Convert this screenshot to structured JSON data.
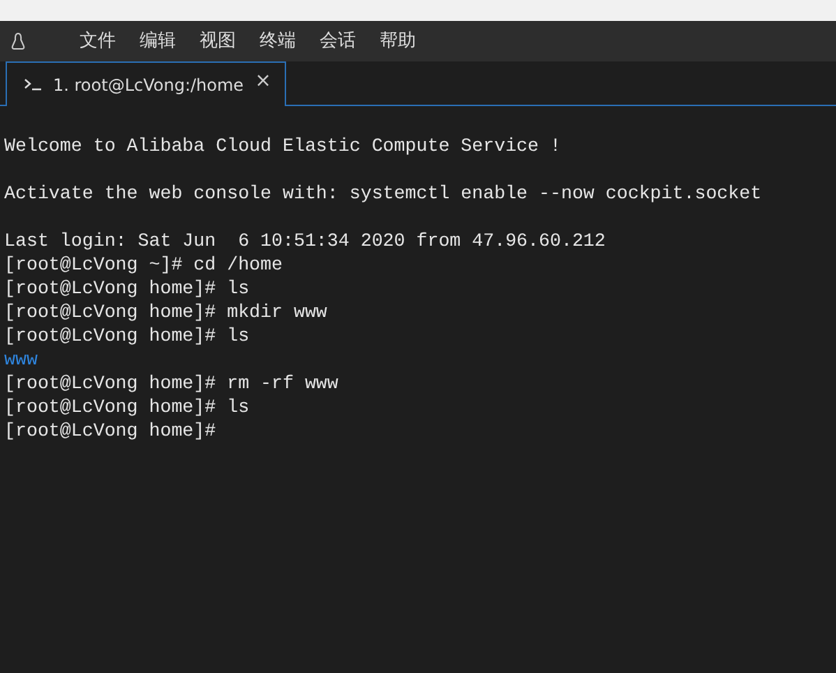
{
  "menu": [
    {
      "label": "文件"
    },
    {
      "label": "编辑"
    },
    {
      "label": "视图"
    },
    {
      "label": "终端"
    },
    {
      "label": "会话"
    },
    {
      "label": "帮助"
    }
  ],
  "tabs": [
    {
      "label": "1. root@LcVong:/home",
      "selected": true,
      "close": "×"
    }
  ],
  "terminal": {
    "blocks": [
      {
        "lines": [
          {
            "text": "Welcome to Alibaba Cloud Elastic Compute Service !",
            "kind": "output"
          }
        ]
      },
      {
        "lines": [
          {
            "text": "Activate the web console with: systemctl enable --now cockpit.socket",
            "kind": "output"
          }
        ]
      },
      {
        "lines": [
          {
            "text": "Last login: Sat Jun  6 10:51:34 2020 from 47.96.60.212",
            "kind": "output"
          },
          {
            "text": "[root@LcVong ~]# cd /home",
            "kind": "output"
          },
          {
            "text": "[root@LcVong home]# ls",
            "kind": "output"
          },
          {
            "text": "[root@LcVong home]# mkdir www",
            "kind": "output"
          },
          {
            "text": "[root@LcVong home]# ls",
            "kind": "output"
          },
          {
            "text": "www",
            "kind": "dir"
          },
          {
            "text": "[root@LcVong home]# rm -rf www",
            "kind": "output"
          },
          {
            "text": "[root@LcVong home]# ls",
            "kind": "output"
          },
          {
            "text": "[root@LcVong home]#",
            "kind": "output"
          }
        ]
      }
    ]
  }
}
